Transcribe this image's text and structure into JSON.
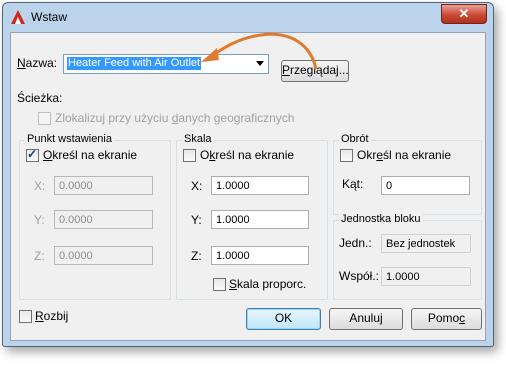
{
  "window": {
    "title": "Wstaw",
    "close_glyph": "✕"
  },
  "name_row": {
    "label_pre": "",
    "label_u": "N",
    "label_post": "azwa:",
    "value": "Heater Feed with Air Outlet",
    "browse_pre": "",
    "browse_u": "P",
    "browse_post": "rzeglądaj..."
  },
  "path": {
    "label": "Ścieżka:"
  },
  "geo": {
    "pre": "Zlokalizuj przy użyciu ",
    "u": "d",
    "post": "anych geograficznych"
  },
  "insertion": {
    "title": "Punkt wstawienia",
    "specify_pre": "",
    "specify_u": "O",
    "specify_post": "kreśl na ekranie",
    "x_label": "X:",
    "y_label": "Y:",
    "z_label": "Z:",
    "x": "0.0000",
    "y": "0.0000",
    "z": "0.0000"
  },
  "scale": {
    "title": "Skala",
    "specify_pre": "O",
    "specify_u": "k",
    "specify_post": "reśl na ekranie",
    "x_label": "X:",
    "y_label": "Y:",
    "z_label": "Z:",
    "x": "1.0000",
    "y": "1.0000",
    "z": "1.0000",
    "uniform_pre": "",
    "uniform_u": "S",
    "uniform_post": "kala proporc."
  },
  "rotation": {
    "title": "Obrót",
    "specify_pre": "Okr",
    "specify_u": "e",
    "specify_post": "śl na ekranie",
    "angle_label": "Kąt:",
    "angle": "0"
  },
  "block_unit": {
    "title": "Jednostka bloku",
    "unit_label": "Jedn.:",
    "unit_value": "Bez jednostek",
    "factor_label": "Współ.:",
    "factor_value": "1.0000"
  },
  "explode": {
    "pre": "",
    "u": "R",
    "post": "ozbij"
  },
  "buttons": {
    "ok": "OK",
    "cancel": "Anuluj",
    "help_pre": "Pomo",
    "help_u": "c",
    "help_post": ""
  },
  "colors": {
    "accent_arrow": "#e07a2e",
    "selection": "#3399ff"
  }
}
